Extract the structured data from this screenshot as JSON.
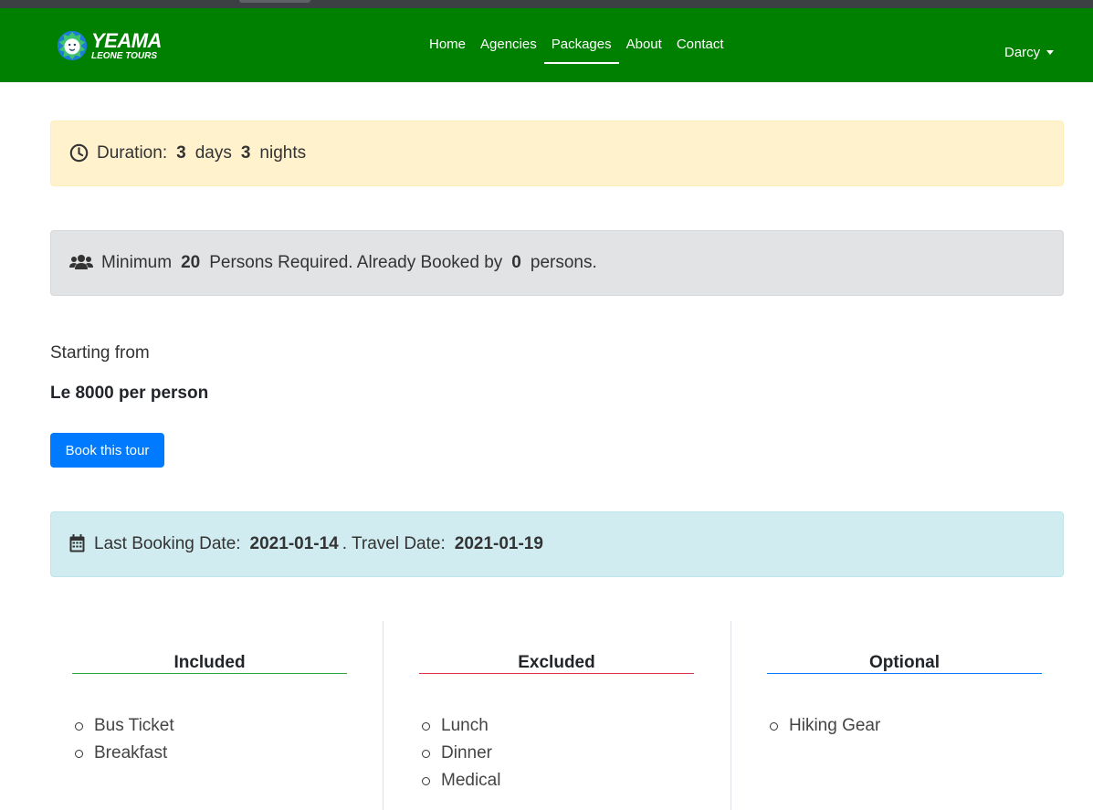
{
  "navbar": {
    "brand_line1": "YEAMA",
    "brand_line2": "LEONE TOURS",
    "links": [
      "Home",
      "Agencies",
      "Packages",
      "About",
      "Contact"
    ],
    "active_link": "Packages",
    "user_name": "Darcy",
    "background_color": "#008000"
  },
  "duration": {
    "prefix": "Duration:",
    "days": "3",
    "days_label": "days",
    "nights": "3",
    "nights_label": "nights",
    "icon": "clock-icon"
  },
  "persons": {
    "prefix": "Minimum",
    "minimum": "20",
    "middle": "Persons Required. Already Booked by",
    "booked": "0",
    "suffix": "persons.",
    "icon": "users-icon"
  },
  "pricing": {
    "starting_label": "Starting from",
    "price": "Le 8000 per person",
    "book_button": "Book this tour",
    "button_color": "#007bff"
  },
  "dates": {
    "last_booking_label": "Last Booking Date:",
    "last_booking_date": "2021-01-14",
    "separator": ". Travel Date:",
    "travel_date": "2021-01-19",
    "icon": "calendar-icon"
  },
  "columns": [
    {
      "title": "Included",
      "color": "#28a745",
      "items": [
        "Bus Ticket",
        "Breakfast"
      ]
    },
    {
      "title": "Excluded",
      "color": "#dc3545",
      "items": [
        "Lunch",
        "Dinner",
        "Medical"
      ]
    },
    {
      "title": "Optional",
      "color": "#007bff",
      "items": [
        "Hiking Gear"
      ]
    }
  ]
}
